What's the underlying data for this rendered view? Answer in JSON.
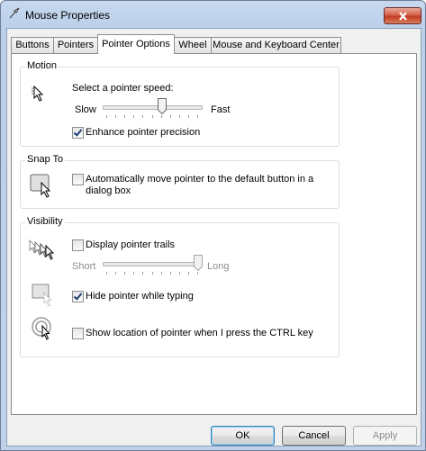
{
  "window": {
    "title": "Mouse Properties",
    "title_icon": "mouse-pointer-icon",
    "close_icon": "close-icon"
  },
  "tabs": [
    {
      "label": "Buttons"
    },
    {
      "label": "Pointers"
    },
    {
      "label": "Pointer Options",
      "active": true
    },
    {
      "label": "Wheel"
    },
    {
      "label": "Mouse and Keyboard Center"
    }
  ],
  "motion": {
    "group_title": "Motion",
    "speed_label": "Select a pointer speed:",
    "slow_label": "Slow",
    "fast_label": "Fast",
    "speed_value_fraction": 0.6,
    "precision_label": "Enhance pointer precision",
    "precision_checked": true
  },
  "snap_to": {
    "group_title": "Snap To",
    "snap_label_line1": "Automatically move pointer to the default button in a",
    "snap_label_line2": "dialog box",
    "snap_checked": false
  },
  "visibility": {
    "group_title": "Visibility",
    "trails_label": "Display pointer trails",
    "trails_checked": false,
    "short_label": "Short",
    "long_label": "Long",
    "trails_value_fraction": 1.0,
    "hide_label": "Hide pointer while typing",
    "hide_checked": true,
    "show_location_label": "Show location of pointer when I press the CTRL key",
    "show_location_checked": false
  },
  "buttons": {
    "ok": "OK",
    "cancel": "Cancel",
    "apply": "Apply"
  },
  "colors": {
    "titlebar": "#bfd2ea",
    "close_button": "#c1391f",
    "check_mark": "#1c3e74"
  }
}
